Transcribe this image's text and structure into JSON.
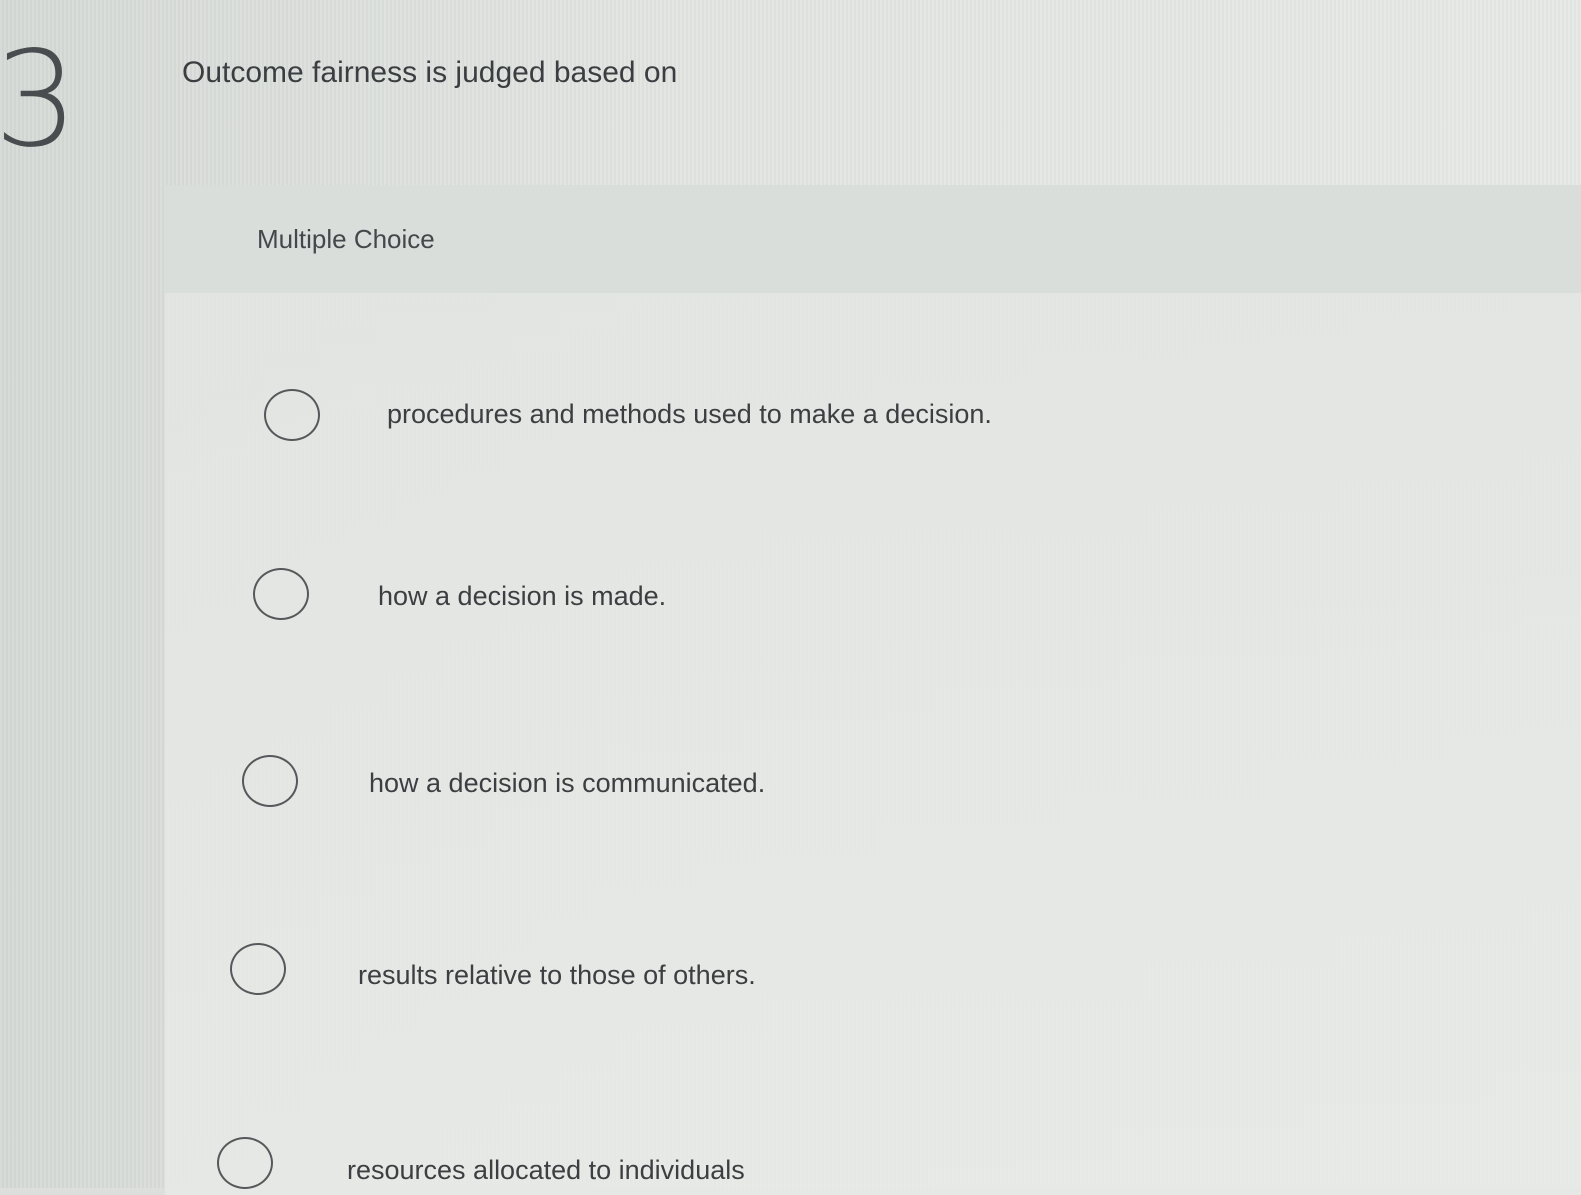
{
  "question": {
    "number": "3",
    "text": "Outcome fairness is judged based on"
  },
  "choice_type": "Multiple Choice",
  "choices": [
    {
      "label": "procedures and methods used to make a decision."
    },
    {
      "label": "how a decision is made."
    },
    {
      "label": "how a decision is communicated."
    },
    {
      "label": "results relative to those of others."
    },
    {
      "label": "resources allocated to individuals"
    }
  ]
}
